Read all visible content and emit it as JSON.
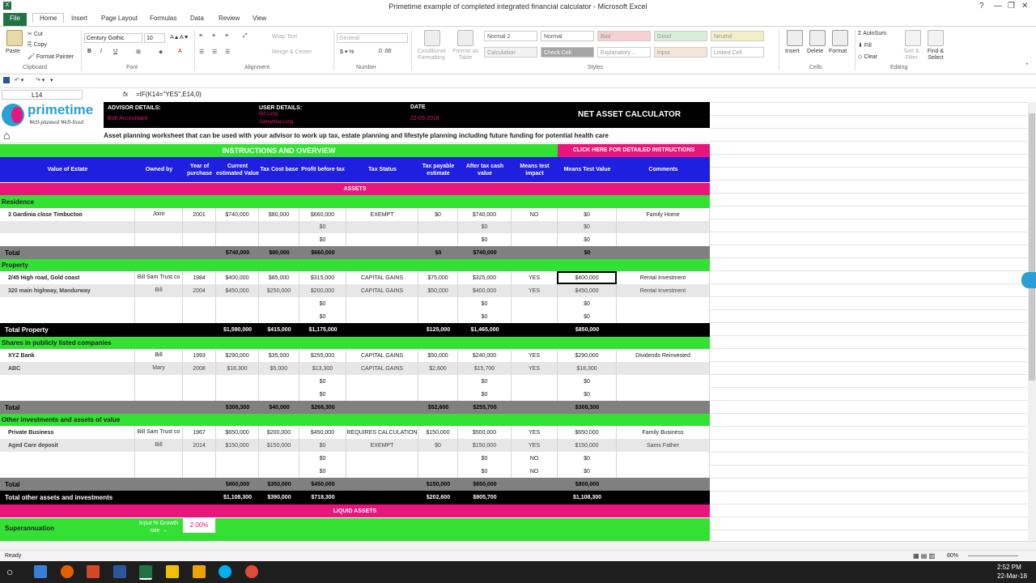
{
  "window": {
    "title": "Primetime example of completed integrated financial calculator - Microsoft Excel",
    "help": "?",
    "minimize": "—",
    "restore": "❐",
    "close": "✕"
  },
  "tabs": [
    "File",
    "Home",
    "Insert",
    "Page Layout",
    "Formulas",
    "Data",
    "Review",
    "View"
  ],
  "ribbon": {
    "paste": "Paste",
    "cut": "Cut",
    "copy": "Copy",
    "format_painter": "Format Painter",
    "clipboard": "Clipboard",
    "font_name": "Century Gothic",
    "font_size": "10",
    "font_group": "Font",
    "wrap_text": "Wrap Text",
    "merge_center": "Merge & Center",
    "alignment": "Alignment",
    "number_format": "General",
    "number": "Number",
    "conditional_formatting": "Conditional Formatting",
    "format_as_table": "Format as Table",
    "styles": [
      {
        "label": "Normal 2",
        "bg": "#ffffff",
        "color": "#555"
      },
      {
        "label": "Normal",
        "bg": "#ffffff",
        "color": "#555"
      },
      {
        "label": "Bad",
        "bg": "#f5d0d0",
        "color": "#999"
      },
      {
        "label": "Good",
        "bg": "#d8eed8",
        "color": "#999"
      },
      {
        "label": "Neutral",
        "bg": "#f5efc8",
        "color": "#999"
      },
      {
        "label": "Calculation",
        "bg": "#f2f2f2",
        "color": "#999"
      },
      {
        "label": "Check Cell",
        "bg": "#a5a5a5",
        "color": "#fff"
      },
      {
        "label": "Explanatory ...",
        "bg": "#ffffff",
        "color": "#999"
      },
      {
        "label": "Input",
        "bg": "#f5e6d8",
        "color": "#999"
      },
      {
        "label": "Linked Cell",
        "bg": "#ffffff",
        "color": "#999"
      }
    ],
    "styles_group": "Styles",
    "insert": "Insert",
    "delete": "Delete",
    "format": "Format",
    "cells": "Cells",
    "autosum": "AutoSum",
    "fill": "Fill",
    "clear": "Clear",
    "sort_filter": "Sort & Filter",
    "find_select": "Find & Select",
    "editing": "Editing"
  },
  "formula_bar": {
    "name_box": "L14",
    "fx": "fx",
    "formula": "=IF(K14=\"YES\",E14,0)"
  },
  "header": {
    "brand": "primetime",
    "tagline": "Well-planned Well-lived",
    "advisor_label": "ADVISOR DETAILS:",
    "advisor_name": "Bob Accountant",
    "user_label": "USER DETAILS:",
    "user_1": "Bill Long",
    "user_2": "Samantha Long",
    "date_label": "DATE",
    "date_value": "22-03-2018",
    "calc_title": "NET ASSET CALCULATOR"
  },
  "description": "Asset planning worksheet that can be used with your advisor to work up tax, estate planning and lifestyle planning including future funding for potential health care",
  "instructions": "INSTRUCTIONS AND OVERVIEW",
  "instructions_link": "CLICK HERE FOR DETAILED INSTRUCTIONS",
  "columns": [
    "Value of Estate",
    "Owned by",
    "Year of purchase",
    "Current estimated Value",
    "Tax Cost base",
    "Profit before tax",
    "Tax Status",
    "Tax payable estimate",
    "After tax cash value",
    "Means test impact",
    "Means Test Value",
    "Comments"
  ],
  "rows": [
    {
      "style": "pink",
      "cells": [
        "",
        "",
        "",
        "",
        "",
        "",
        "ASSETS",
        "",
        "",
        "",
        "",
        ""
      ]
    },
    {
      "style": "green",
      "cells": [
        "Residence",
        "",
        "",
        "",
        "",
        "",
        "",
        "",
        "",
        "",
        "",
        ""
      ]
    },
    {
      "style": "white",
      "cells": [
        "3 Gardinia close Timbuctoo",
        "Joint",
        "2001",
        "$740,000",
        "$80,000",
        "$660,000",
        "EXEMPT",
        "$0",
        "$740,000",
        "NO",
        "$0",
        "Family Home"
      ]
    },
    {
      "style": "gray",
      "cells": [
        "",
        "",
        "",
        "",
        "",
        "$0",
        "",
        "",
        "$0",
        "",
        "$0",
        ""
      ]
    },
    {
      "style": "white",
      "cells": [
        "",
        "",
        "",
        "",
        "",
        "$0",
        "",
        "",
        "$0",
        "",
        "$0",
        ""
      ]
    },
    {
      "style": "dark",
      "cells": [
        "Total",
        "",
        "",
        "$740,000",
        "$80,000",
        "$660,000",
        "",
        "$0",
        "$740,000",
        "",
        "$0",
        ""
      ]
    },
    {
      "style": "green",
      "cells": [
        "Property",
        "",
        "",
        "",
        "",
        "",
        "",
        "",
        "",
        "",
        "",
        ""
      ]
    },
    {
      "style": "white",
      "cells": [
        "2/45 High road, Gold coast",
        "Bill Sam Trust co",
        "1984",
        "$400,000",
        "$85,000",
        "$315,000",
        "CAPITAL GAINS",
        "$75,000",
        "$325,000",
        "YES",
        "$400,000",
        "Rental Investment"
      ]
    },
    {
      "style": "gray",
      "cells": [
        "320 main highway, Mandurway",
        "Bill",
        "2004",
        "$450,000",
        "$250,000",
        "$200,000",
        "CAPITAL GAINS",
        "$50,000",
        "$400,000",
        "YES",
        "$450,000",
        "Rental Investment"
      ]
    },
    {
      "style": "white",
      "cells": [
        "",
        "",
        "",
        "",
        "",
        "$0",
        "",
        "",
        "$0",
        "",
        "$0",
        ""
      ]
    },
    {
      "style": "white",
      "cells": [
        "",
        "",
        "",
        "",
        "",
        "$0",
        "",
        "",
        "$0",
        "",
        "$0",
        ""
      ]
    },
    {
      "style": "black",
      "cells": [
        "Total Property",
        "",
        "",
        "$1,590,000",
        "$415,000",
        "$1,175,000",
        "",
        "$125,000",
        "$1,465,000",
        "",
        "$850,000",
        ""
      ]
    },
    {
      "style": "green",
      "cells": [
        "Shares in publicly listed companies",
        "",
        "",
        "",
        "",
        "",
        "",
        "",
        "",
        "",
        "",
        ""
      ]
    },
    {
      "style": "white",
      "cells": [
        "XYZ Bank",
        "Bill",
        "1993",
        "$290,000",
        "$35,000",
        "$255,000",
        "CAPITAL GAINS",
        "$50,000",
        "$240,000",
        "YES",
        "$290,000",
        "Dividends Reinvested"
      ]
    },
    {
      "style": "gray",
      "cells": [
        "ABC",
        "Mary",
        "2008",
        "$18,300",
        "$5,000",
        "$13,300",
        "CAPITAL GAINS",
        "$2,600",
        "$15,700",
        "YES",
        "$18,300",
        ""
      ]
    },
    {
      "style": "white",
      "cells": [
        "",
        "",
        "",
        "",
        "",
        "$0",
        "",
        "",
        "$0",
        "",
        "$0",
        ""
      ]
    },
    {
      "style": "white",
      "cells": [
        "",
        "",
        "",
        "",
        "",
        "$0",
        "",
        "",
        "$0",
        "",
        "$0",
        ""
      ]
    },
    {
      "style": "dark",
      "cells": [
        "Total",
        "",
        "",
        "$308,300",
        "$40,000",
        "$268,300",
        "",
        "$52,600",
        "$255,700",
        "",
        "$308,300",
        ""
      ]
    },
    {
      "style": "green",
      "cells": [
        "Other investments and assets of value",
        "",
        "",
        "",
        "",
        "",
        "",
        "",
        "",
        "",
        "",
        ""
      ]
    },
    {
      "style": "white",
      "cells": [
        "Private Business",
        "Bill Sam Trust co",
        "1967",
        "$650,000",
        "$200,000",
        "$450,000",
        "REQUIRES CALCULATION",
        "$150,000",
        "$500,000",
        "YES",
        "$650,000",
        "Family Business"
      ]
    },
    {
      "style": "gray",
      "cells": [
        "Aged Care deposit",
        "Bill",
        "2014",
        "$150,000",
        "$150,000",
        "$0",
        "EXEMPT",
        "$0",
        "$150,000",
        "YES",
        "$150,000",
        "Sams Father"
      ]
    },
    {
      "style": "white",
      "cells": [
        "",
        "",
        "",
        "",
        "",
        "$0",
        "",
        "",
        "$0",
        "NO",
        "$0",
        ""
      ]
    },
    {
      "style": "white",
      "cells": [
        "",
        "",
        "",
        "",
        "",
        "$0",
        "",
        "",
        "$0",
        "NO",
        "$0",
        ""
      ]
    },
    {
      "style": "dark",
      "cells": [
        "Total",
        "",
        "",
        "$800,000",
        "$350,000",
        "$450,000",
        "",
        "$150,000",
        "$650,000",
        "",
        "$800,000",
        ""
      ]
    },
    {
      "style": "black",
      "cells": [
        "Total other assets and investments",
        "",
        "",
        "$1,108,300",
        "$390,000",
        "$718,300",
        "",
        "$202,600",
        "$905,700",
        "",
        "$1,108,300",
        ""
      ]
    },
    {
      "style": "pink",
      "cells": [
        "",
        "",
        "",
        "",
        "",
        "",
        "LIQUID ASSETS",
        "",
        "",
        "",
        "",
        ""
      ]
    }
  ],
  "superannuation": {
    "label": "Superannuation",
    "growth_label": "Input % Growth rate →",
    "growth_value": "2.00%"
  },
  "status": {
    "ready": "Ready",
    "zoom": "80%"
  },
  "clock": {
    "time": "2:52 PM",
    "date": "22-Mar-18"
  },
  "colors": {
    "green": "#33e033",
    "blue": "#1f1fe0",
    "pink": "#e8157a",
    "excel_green": "#217346"
  }
}
